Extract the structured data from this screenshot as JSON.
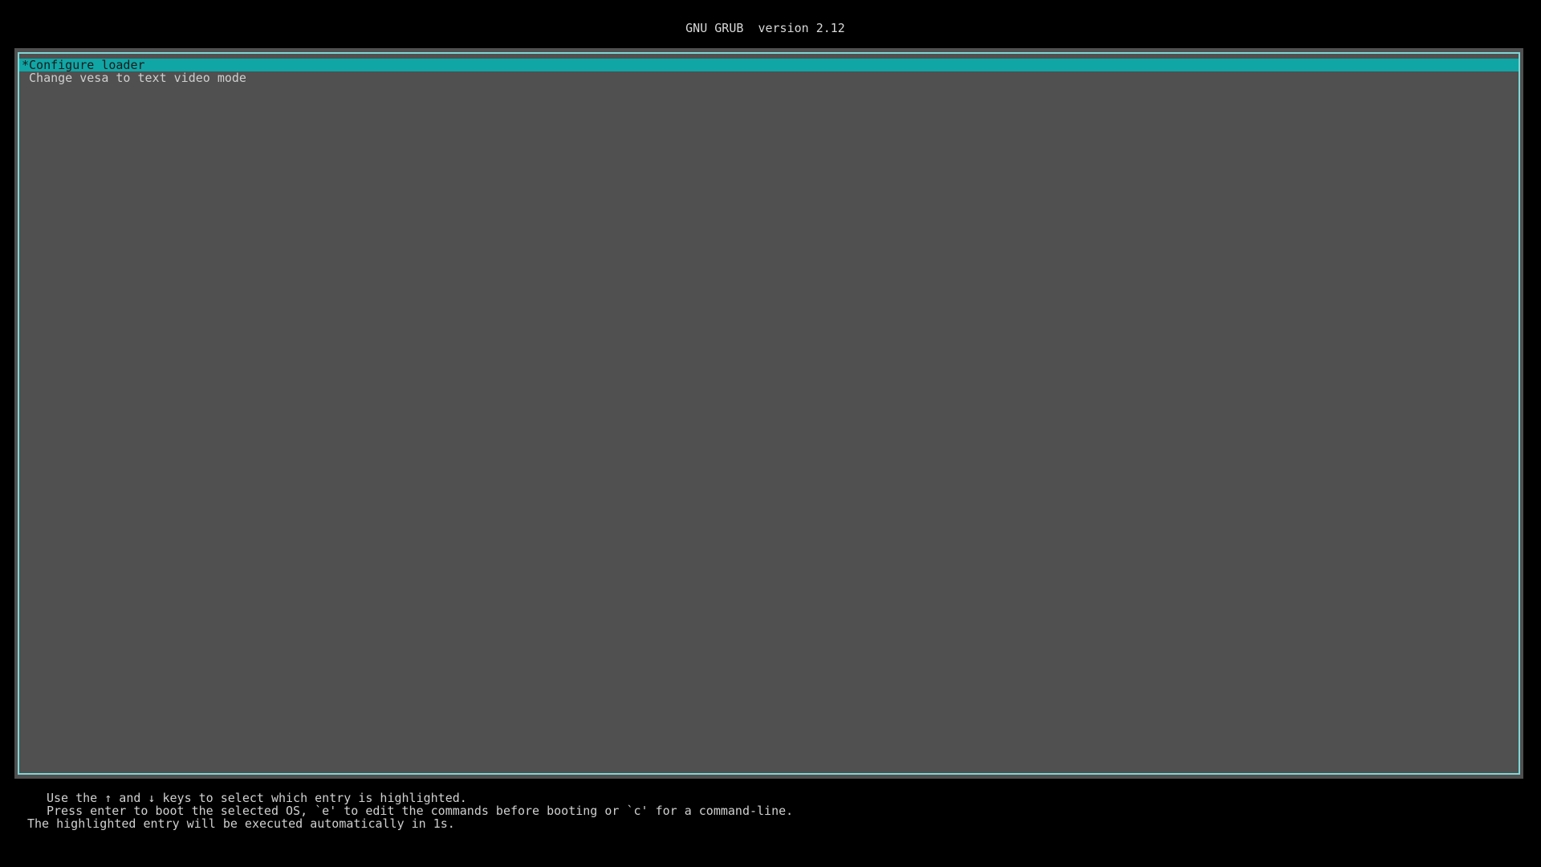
{
  "header": {
    "title": "GNU GRUB  version 2.12"
  },
  "menu": {
    "entries": [
      {
        "label": "*Configure loader",
        "selected": true
      },
      {
        "label": " Change vesa to text video mode",
        "selected": false
      }
    ]
  },
  "help": {
    "line1": "Use the ↑ and ↓ keys to select which entry is highlighted.",
    "line2": "Press enter to boot the selected OS, `e' to edit the commands before booting or `c' for a command-line.",
    "line3": "The highlighted entry will be executed automatically in 1s."
  },
  "colors": {
    "background": "#000000",
    "menu_background": "#505050",
    "border": "#7fd6d6",
    "highlight": "#10a6a6"
  }
}
